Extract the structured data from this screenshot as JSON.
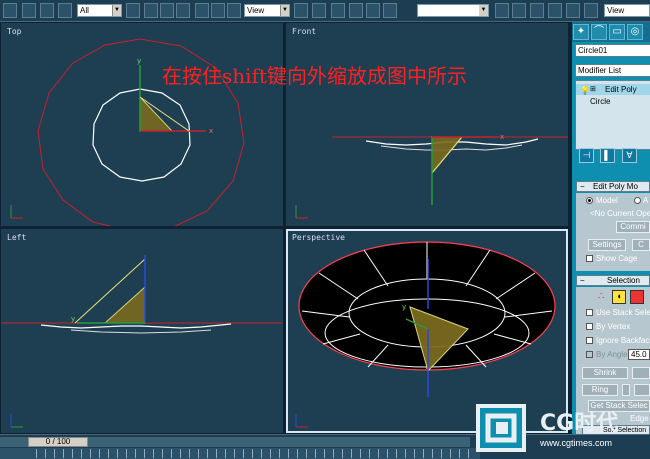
{
  "toolbar": {
    "selection_filter": "All",
    "reference_coord": "View",
    "snap_view": "View",
    "named_selection": ""
  },
  "viewports": [
    {
      "label": "Top"
    },
    {
      "label": "Front"
    },
    {
      "label": "Left"
    },
    {
      "label": "Perspective"
    }
  ],
  "overlay_caption": "在按住shift键向外缩放成图中所示",
  "command_panel": {
    "tabs": [
      "create-icon",
      "modify-icon",
      "hierarchy-icon",
      "motion-icon"
    ],
    "object_name": "Circle01",
    "modifier_list": "Modifier List",
    "stack": [
      {
        "label": "Edit Poly",
        "selected": true
      },
      {
        "label": "Circle",
        "selected": false
      }
    ],
    "edit_poly_mode": {
      "title": "Edit Poly Mo",
      "model_label": "Model",
      "animate_label": "A",
      "current_op": "<No Current Ope",
      "commit_label": "Commi",
      "settings_label": "Settings",
      "cancel_label": "C",
      "show_cage_label": "Show Cage"
    },
    "selection": {
      "title": "Selection",
      "use_stack_label": "Use Stack Selec",
      "by_vertex_label": "By Vertex",
      "ignore_backfacing_label": "Ignore Backfacin",
      "by_angle_label": "By Angle:",
      "angle_value": "45.0",
      "shrink_label": "Shrink",
      "grow_label": "",
      "ring_label": "Ring",
      "loop_label": "",
      "get_stack_label": "Get Stack Selec",
      "edge_label": "Edge",
      "soft_label": "Soft Selection"
    }
  },
  "timeline": {
    "frame_display": "0 / 100"
  },
  "watermark": {
    "text": "CG时代",
    "url": "www.cgtimes.com"
  },
  "colors": {
    "viewport_bg": "#1e3f52",
    "panel_bg": "#0f8fb0",
    "caption": "#ff2020",
    "gizmo": "#e8e07a"
  }
}
